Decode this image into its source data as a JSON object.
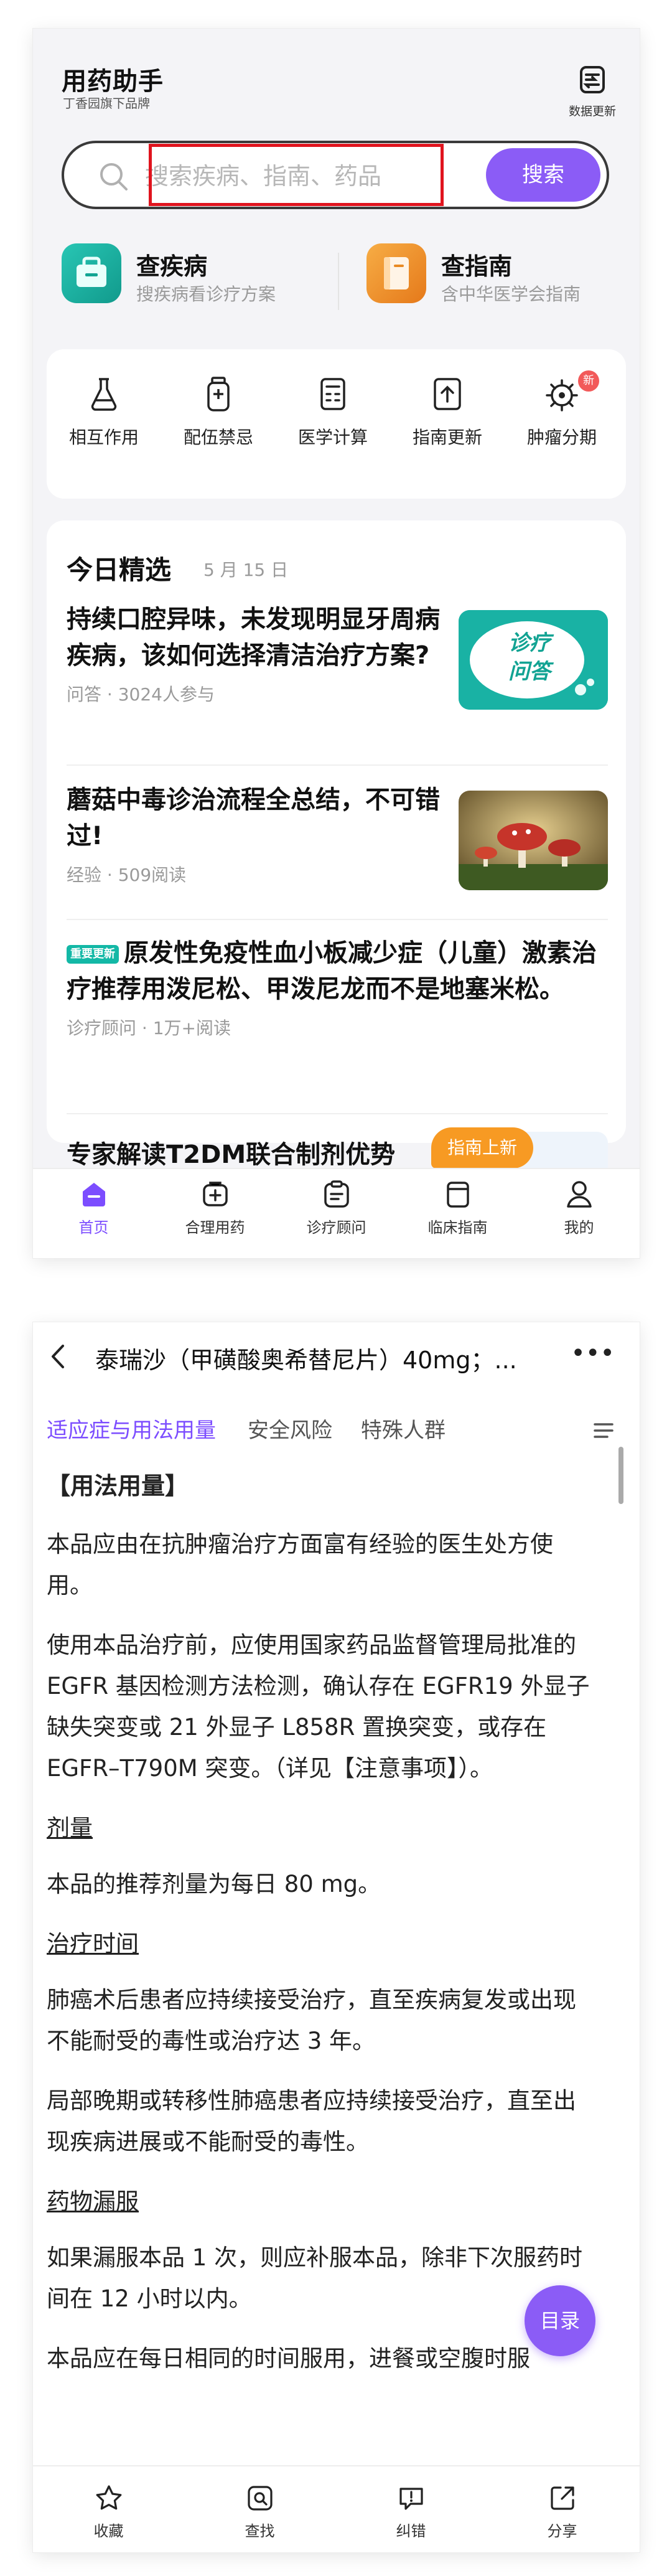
{
  "screen1": {
    "app_title": "用药助手",
    "app_subtitle": "丁香园旗下品牌",
    "data_update_label": "数据更新",
    "search": {
      "placeholder": "搜索疾病、指南、药品",
      "button_label": "搜索"
    },
    "quick_links": [
      {
        "title": "查疾病",
        "subtitle": "搜疾病看诊疗方案",
        "icon": "case-bag-icon",
        "color": "#1fb8a8"
      },
      {
        "title": "查指南",
        "subtitle": "含中华医学会指南",
        "icon": "book-icon",
        "color": "#f39a2a"
      }
    ],
    "tools": [
      {
        "label": "相互作用",
        "icon": "flask-icon"
      },
      {
        "label": "配伍禁忌",
        "icon": "bottle-icon"
      },
      {
        "label": "医学计算",
        "icon": "calculator-icon"
      },
      {
        "label": "指南更新",
        "icon": "upload-doc-icon"
      },
      {
        "label": "肿瘤分期",
        "icon": "cell-icon",
        "badge": "新"
      }
    ],
    "today": {
      "title": "今日精选",
      "date": "5 月 15 日",
      "articles": [
        {
          "title": "持续口腔异味，未发现明显牙周病疾病，该如何选择清洁治疗方案?",
          "meta": "问答 · 3024人参与",
          "thumb_text": "诊疗问答"
        },
        {
          "title": "蘑菇中毒诊治流程全总结，不可错过!",
          "meta": "经验 · 509阅读"
        },
        {
          "tag": "重要更新",
          "title": "原发性免疫性血小板减少症（儿童）激素治疗推荐用泼尼松、甲泼尼龙而不是地塞米松。",
          "meta": "诊疗顾问 · 1万+阅读"
        },
        {
          "title": "专家解读T2DM联合制剂优势",
          "meta": ""
        }
      ]
    },
    "popup_label": "指南上新",
    "tabs": [
      {
        "label": "首页",
        "icon": "home-icon",
        "active": true
      },
      {
        "label": "合理用药",
        "icon": "pill-box-icon"
      },
      {
        "label": "诊疗顾问",
        "icon": "clipboard-icon"
      },
      {
        "label": "临床指南",
        "icon": "guide-book-icon"
      },
      {
        "label": "我的",
        "icon": "user-icon"
      }
    ],
    "accent_color": "#8b5cf6"
  },
  "screen2": {
    "nav_title": "泰瑞沙（甲磺酸奥希替尼片）40mg；...",
    "subtabs": [
      "适应症与用法用量",
      "安全风险",
      "特殊人群"
    ],
    "section_heading": "【用法用量】",
    "paragraphs": {
      "p1": "本品应由在抗肿瘤治疗方面富有经验的医生处方使用。",
      "p2": "使用本品治疗前，应使用国家药品监督管理局批准的 EGFR 基因检测方法检测，确认存在 EGFR19 外显子缺失突变或 21 外显子 L858R 置换突变，或存在 EGFR–T790M 突变。（详见【注意事项】）。",
      "h_dose": "剂量",
      "p3": "本品的推荐剂量为每日 80 mg。",
      "h_time": "治疗时间",
      "p4": "肺癌术后患者应持续接受治疗，直至疾病复发或出现不能耐受的毒性或治疗达 3 年。",
      "p5": "局部晚期或转移性肺癌患者应持续接受治疗，直至出现疾病进展或不能耐受的毒性。",
      "h_missed": "药物漏服",
      "p6": "如果漏服本品 1 次，则应补服本品，除非下次服药时间在 12 小时以内。",
      "p7": "本品应在每日相同的时间服用，进餐或空腹时服"
    },
    "toc_label": "目录",
    "bottom_actions": [
      {
        "label": "收藏",
        "icon": "star-icon"
      },
      {
        "label": "查找",
        "icon": "find-icon"
      },
      {
        "label": "纠错",
        "icon": "error-report-icon"
      },
      {
        "label": "分享",
        "icon": "share-icon"
      }
    ]
  }
}
